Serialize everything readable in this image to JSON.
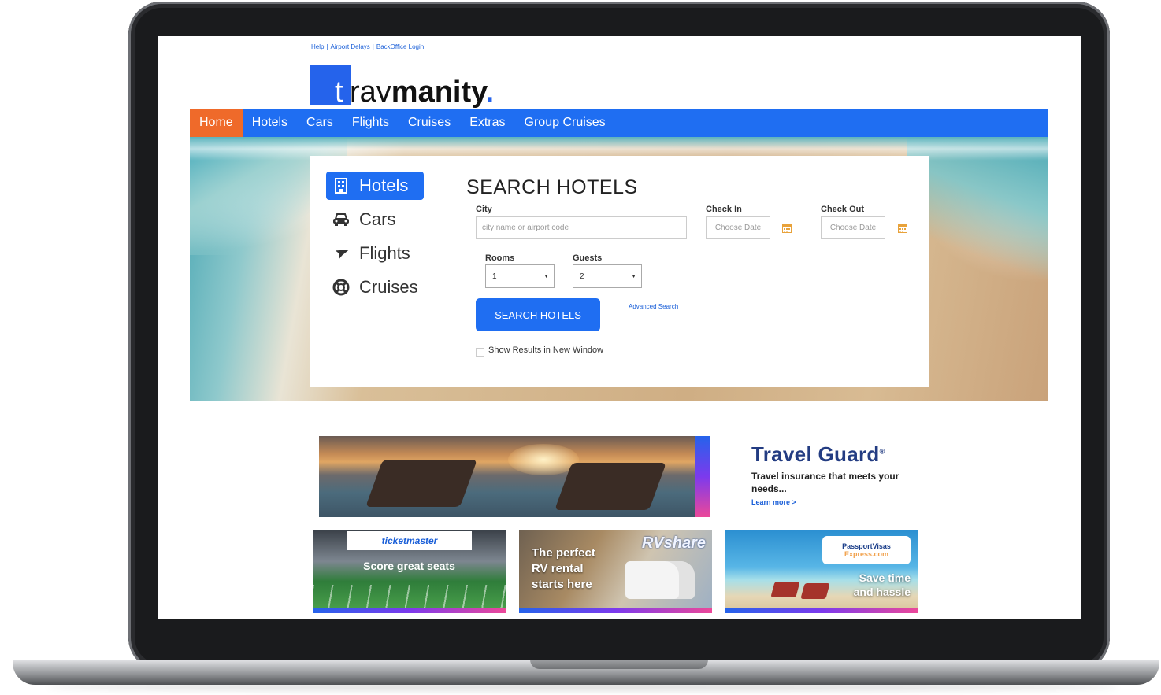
{
  "top_links": [
    "Help",
    "Airport Delays",
    "BackOffice Login"
  ],
  "top_links_sep": "|",
  "logo": {
    "t": "t",
    "light": "rav",
    "bold": "manity",
    "dot": "."
  },
  "nav": [
    "Home",
    "Hotels",
    "Cars",
    "Flights",
    "Cruises",
    "Extras",
    "Group Cruises"
  ],
  "nav_active": "Home",
  "search_tabs": [
    {
      "label": "Hotels",
      "icon": "building-icon"
    },
    {
      "label": "Cars",
      "icon": "car-icon"
    },
    {
      "label": "Flights",
      "icon": "plane-icon"
    },
    {
      "label": "Cruises",
      "icon": "life-ring-icon"
    }
  ],
  "form": {
    "title": "SEARCH HOTELS",
    "city_label": "City",
    "city_placeholder": "city name or airport code",
    "checkin_label": "Check In",
    "checkin_placeholder": "Choose Date",
    "checkout_label": "Check Out",
    "checkout_placeholder": "Choose Date",
    "rooms_label": "Rooms",
    "rooms_value": "1",
    "guests_label": "Guests",
    "guests_value": "2",
    "search_button": "SEARCH HOTELS",
    "advanced_link": "Advanced Search",
    "new_window_label": "Show Results in New Window"
  },
  "ads": {
    "travel_guard": {
      "title": "Travel Guard",
      "reg": "®",
      "subtitle": "Travel insurance that meets your needs...",
      "link": "Learn more >"
    },
    "ticketmaster": {
      "brand": "ticketmaster",
      "text": "Score great seats"
    },
    "rvshare": {
      "brand_a": "RV",
      "brand_b": "share",
      "text": [
        "The perfect",
        "RV rental",
        "starts here"
      ]
    },
    "passport": {
      "brand_a": "PassportVisas",
      "brand_b": "Express.com",
      "text": [
        "Save time",
        "and hassle"
      ]
    }
  },
  "colors": {
    "nav_blue": "#1f6ef2",
    "active_orange": "#ef6a2a",
    "link_blue": "#1a5fd8"
  }
}
